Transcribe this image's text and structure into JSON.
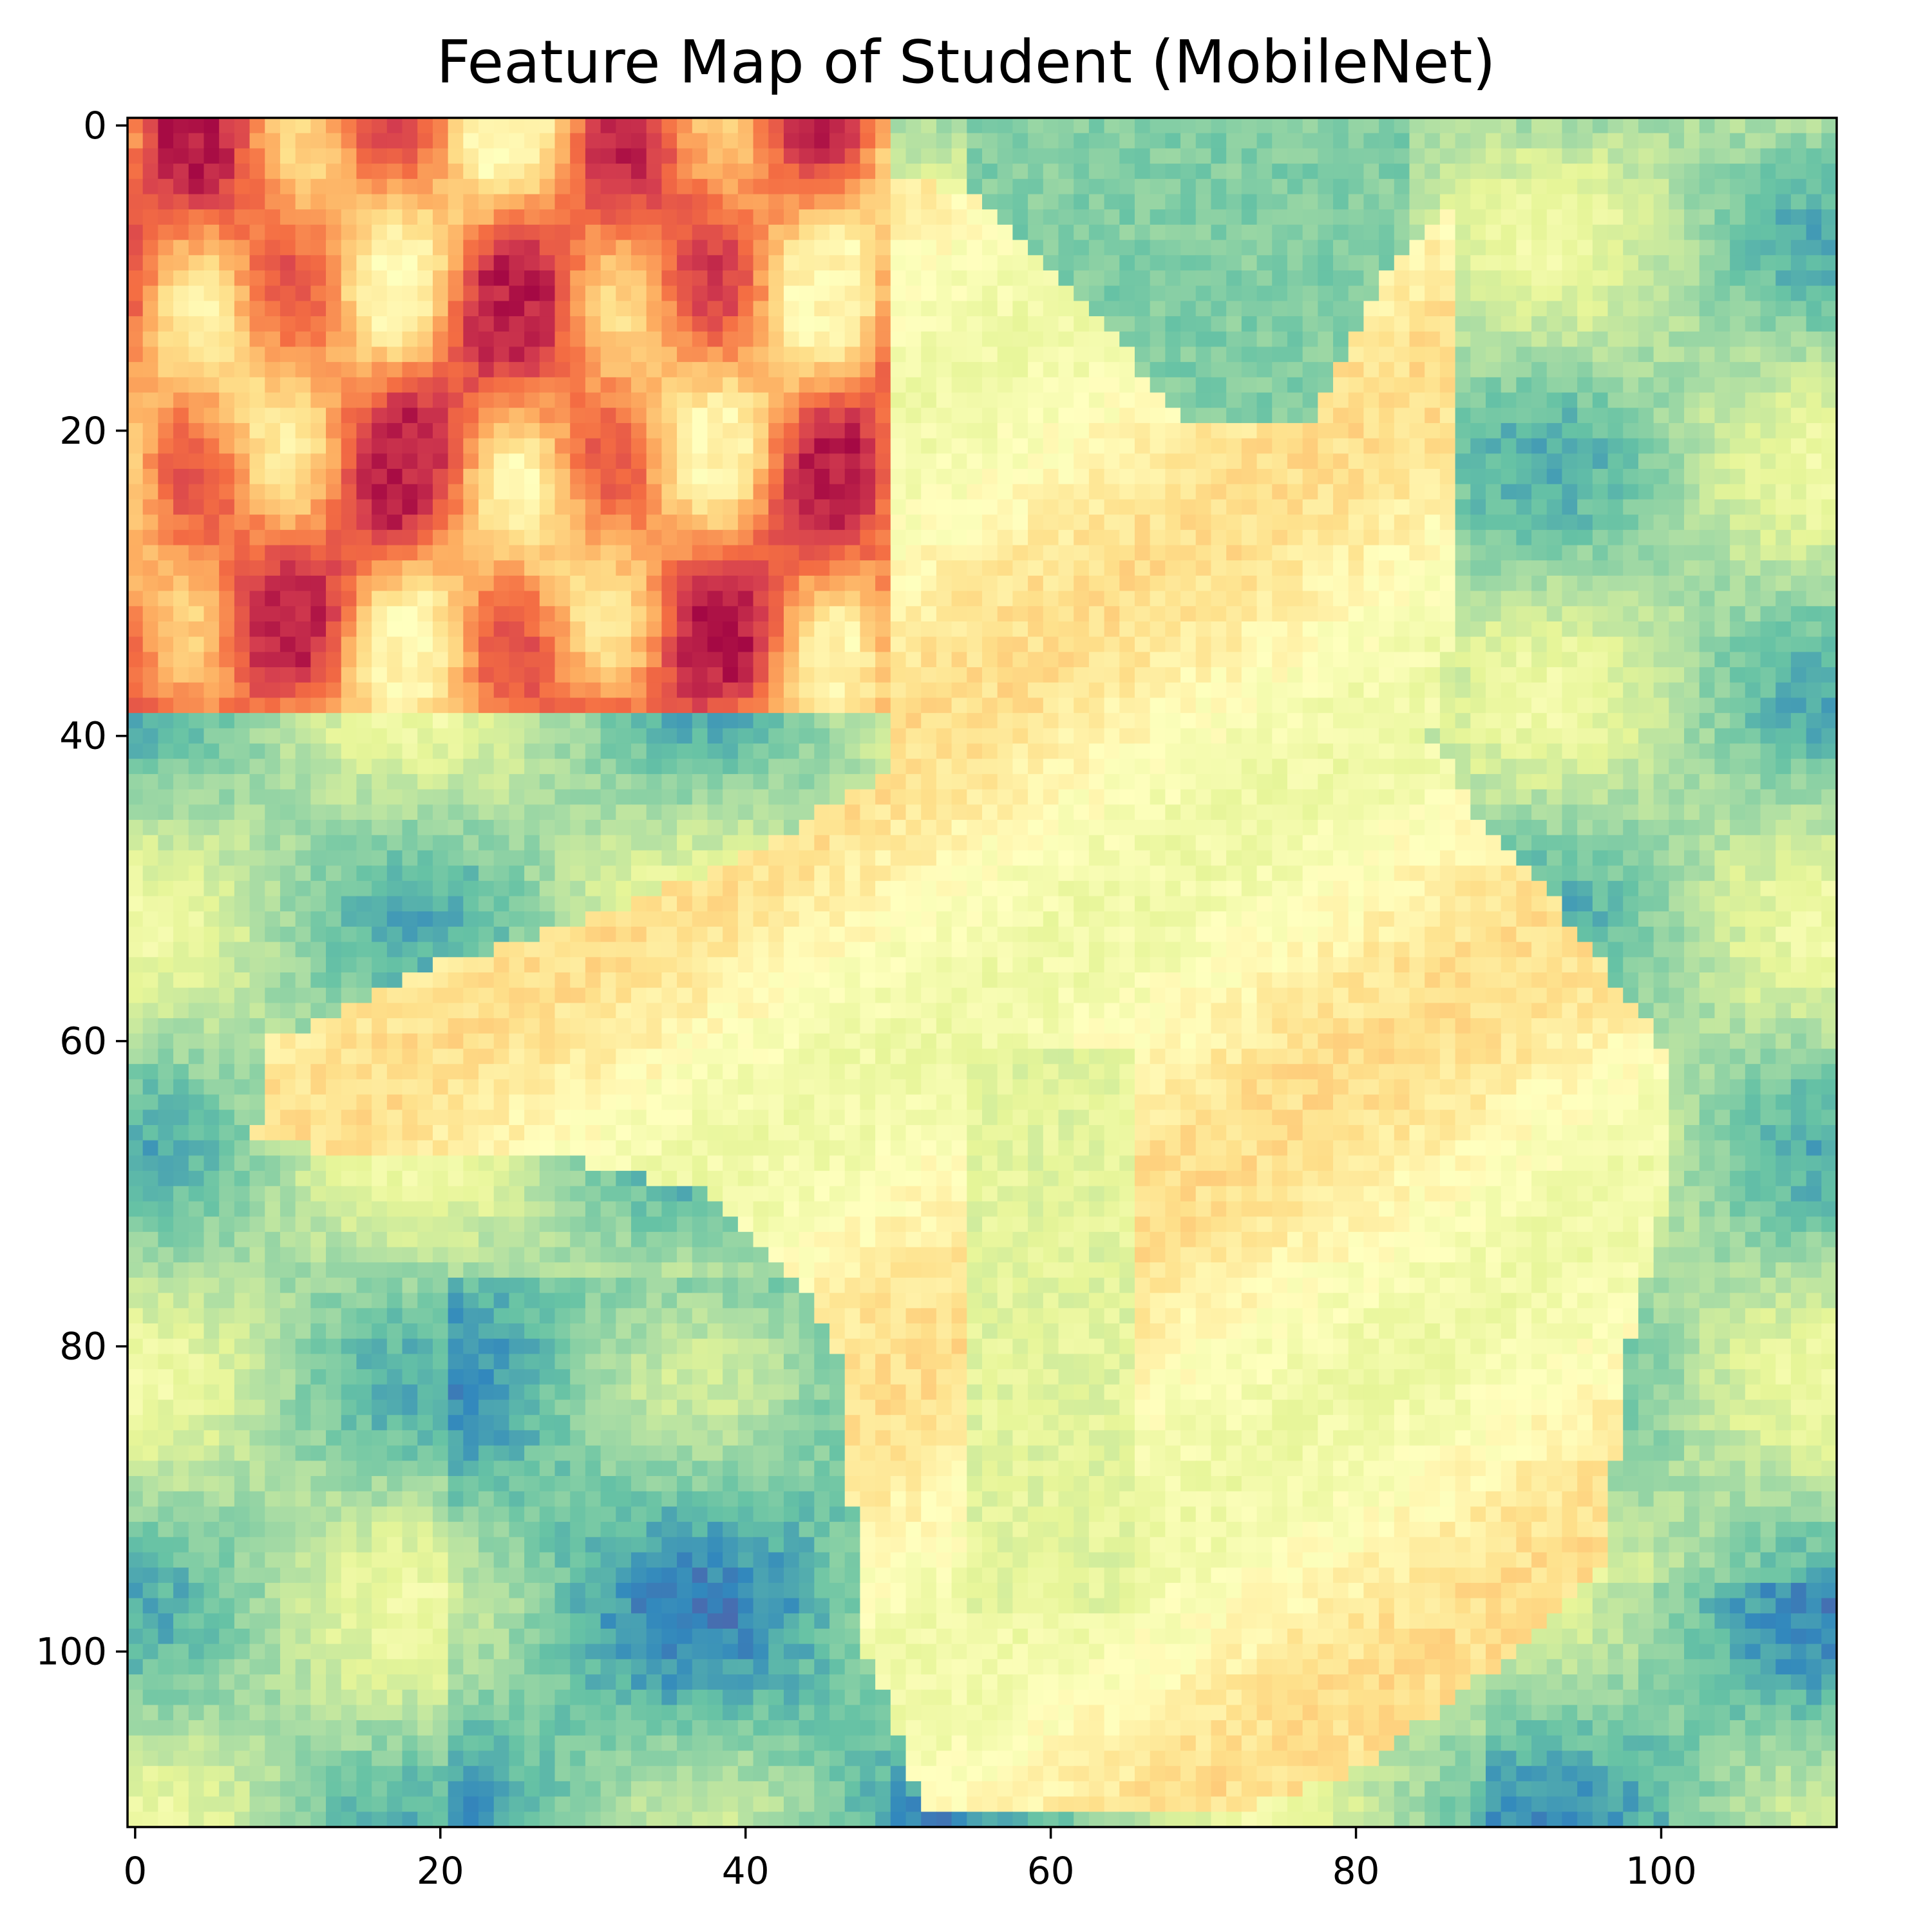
{
  "chart_data": {
    "type": "heatmap",
    "title": "Feature Map of Student (MobileNet)",
    "xlabel": "",
    "ylabel": "",
    "grid": false,
    "colormap": "Spectral",
    "colormap_colors": [
      "#9e0142",
      "#d53e4f",
      "#f46d43",
      "#fdae61",
      "#fee08b",
      "#ffffbf",
      "#e6f598",
      "#abdda4",
      "#66c2a5",
      "#3288bd",
      "#5e4fa2"
    ],
    "shape": [
      112,
      112
    ],
    "xlim": [
      -0.5,
      111.5
    ],
    "ylim": [
      111.5,
      -0.5
    ],
    "xticks": [
      0,
      20,
      40,
      60,
      80,
      100
    ],
    "yticks": [
      0,
      20,
      40,
      60,
      80,
      100
    ],
    "xtick_labels": [
      "0",
      "20",
      "40",
      "60",
      "80",
      "100"
    ],
    "ytick_labels": [
      "0",
      "20",
      "40",
      "60",
      "80",
      "100"
    ]
  }
}
